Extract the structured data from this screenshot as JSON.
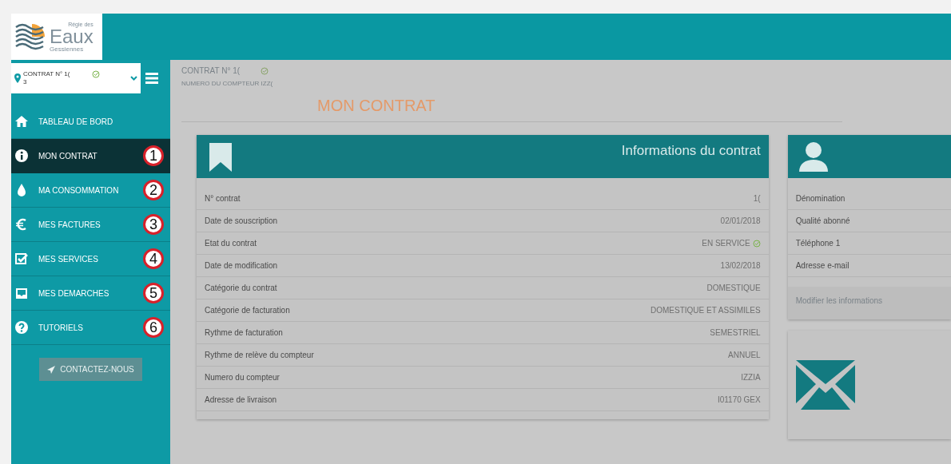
{
  "logo": {
    "small": "Régie des",
    "big": "Eaux",
    "sub": "Gessiennes"
  },
  "contract_selector": {
    "line1": "CONTRAT N° 1(",
    "line2": "3",
    "valid": true
  },
  "sidebar": {
    "items": [
      {
        "kind": "home",
        "label": "TABLEAU DE BORD",
        "selected": false
      },
      {
        "kind": "info",
        "label": "MON CONTRAT",
        "selected": true,
        "badge": "1"
      },
      {
        "kind": "drop",
        "label": "MA CONSOMMATION",
        "selected": false,
        "badge": "2"
      },
      {
        "kind": "euro",
        "label": "MES FACTURES",
        "selected": false,
        "badge": "3"
      },
      {
        "kind": "check",
        "label": "MES SERVICES",
        "selected": false,
        "badge": "4"
      },
      {
        "kind": "inbox",
        "label": "MES DEMARCHES",
        "selected": false,
        "badge": "5"
      },
      {
        "kind": "help",
        "label": "TUTORIELS",
        "selected": false,
        "badge": "6"
      }
    ],
    "contact_button": "CONTACTEZ-NOUS"
  },
  "content_header": {
    "contract": "CONTRAT N° 1(",
    "valid": true,
    "meter": "NUMERO DU COMPTEUR IZZ(",
    "title": "MON CONTRAT"
  },
  "contract_card": {
    "title": "Informations du contrat",
    "rows": [
      {
        "label": "N° contrat",
        "value": "1(",
        "valid": false
      },
      {
        "label": "Date de souscription",
        "value": "02/01/2018",
        "valid": false
      },
      {
        "label": "Etat du contrat",
        "value": "EN SERVICE",
        "valid": true
      },
      {
        "label": "Date de modification",
        "value": "13/02/2018",
        "valid": false
      },
      {
        "label": "Catégorie du contrat",
        "value": "DOMESTIQUE",
        "valid": false
      },
      {
        "label": "Catégorie de facturation",
        "value": "DOMESTIQUE ET ASSIMILES",
        "valid": false
      },
      {
        "label": "Rythme de facturation",
        "value": "SEMESTRIEL",
        "valid": false
      },
      {
        "label": "Rythme de relève du compteur",
        "value": "ANNUEL",
        "valid": false
      },
      {
        "label": "Numero du compteur",
        "value": "IZZIA",
        "valid": false
      },
      {
        "label": "Adresse de livraison",
        "value": "I01170 GEX",
        "valid": false
      }
    ]
  },
  "holder_card": {
    "rows": [
      "Dénomination",
      "Qualité abonné",
      "Téléphone 1",
      "Adresse e-mail"
    ],
    "edit_link": "Modifier les informations"
  }
}
